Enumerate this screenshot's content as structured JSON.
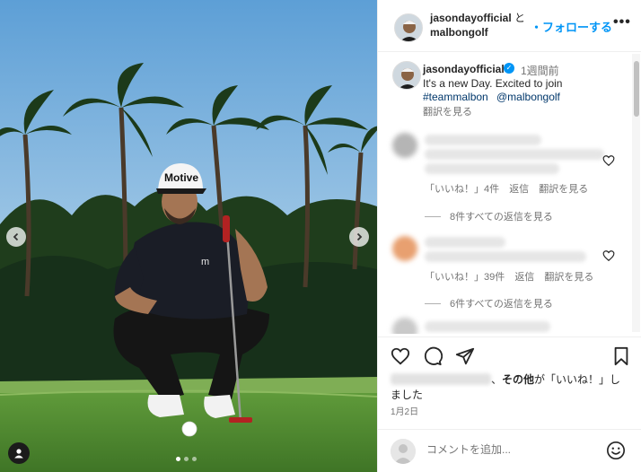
{
  "header": {
    "user1": "jasondayofficial",
    "and": "と",
    "user2": "malbongolf",
    "follow_label": "・フォローする",
    "more_label": "•••"
  },
  "caption": {
    "username": "jasondayofficial",
    "verified_icon": "verified-icon",
    "time": "1週間前",
    "text": "It's a new Day. Excited to join",
    "tag1": "#teammalbon",
    "tag2": "@malbongolf",
    "translate": "翻訳を見る"
  },
  "comments": [
    {
      "likes": "「いいね！」4件",
      "reply": "返信",
      "translate": "翻訳を見る",
      "view_replies": "8件すべての返信を見る"
    },
    {
      "likes": "「いいね！」39件",
      "reply": "返信",
      "translate": "翻訳を見る",
      "view_replies": "6件すべての返信を見る"
    }
  ],
  "likes_line": {
    "sep": "、",
    "others": "その他",
    "suffix": "が「いいね！」し",
    "line2": "ました"
  },
  "date": "1月2日",
  "comment_input": {
    "placeholder": "コメントを追加..."
  },
  "photo": {
    "cap_text": "Motive",
    "carousel_count": 3,
    "carousel_active": 1
  },
  "colors": {
    "accent": "#0095f6",
    "link": "#00376b",
    "secondary_text": "#737373",
    "sky": "#6fa7d6",
    "grass": "#4f8a2e"
  }
}
